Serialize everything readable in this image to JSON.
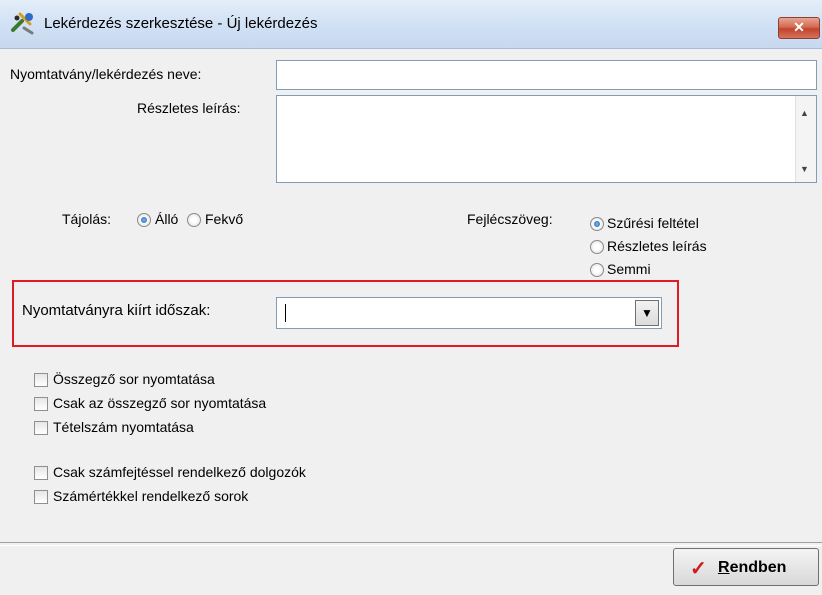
{
  "window": {
    "title": "Lekérdezés szerkesztése - Új lekérdezés",
    "close_label": "✕"
  },
  "form": {
    "name_label": "Nyomtatvány/lekérdezés neve:",
    "name_value": "",
    "desc_label": "Részletes leírás:",
    "desc_value": "",
    "orientation": {
      "label": "Tájolás:",
      "options": [
        "Álló",
        "Fekvő"
      ],
      "selected": "Álló"
    },
    "header_text": {
      "label": "Fejlécszöveg:",
      "options": [
        "Szűrési feltétel",
        "Részletes leírás",
        "Semmi"
      ],
      "selected": "Szűrési feltétel"
    },
    "period": {
      "label": "Nyomtatványra kiírt időszak:",
      "value": ""
    },
    "checkboxes_group1": [
      {
        "label": "Összegző sor nyomtatása",
        "checked": false
      },
      {
        "label": "Csak az összegző sor nyomtatása",
        "checked": false
      },
      {
        "label": "Tételszám nyomtatása",
        "checked": false
      }
    ],
    "checkboxes_group2": [
      {
        "label": "Csak számfejtéssel rendelkező dolgozók",
        "checked": false
      },
      {
        "label": "Számértékkel rendelkező sorok",
        "checked": false
      }
    ]
  },
  "footer": {
    "ok_first_letter": "R",
    "ok_rest": "endben"
  },
  "colors": {
    "highlight_border": "#e01b24",
    "ok_check": "#cc1b1b"
  }
}
